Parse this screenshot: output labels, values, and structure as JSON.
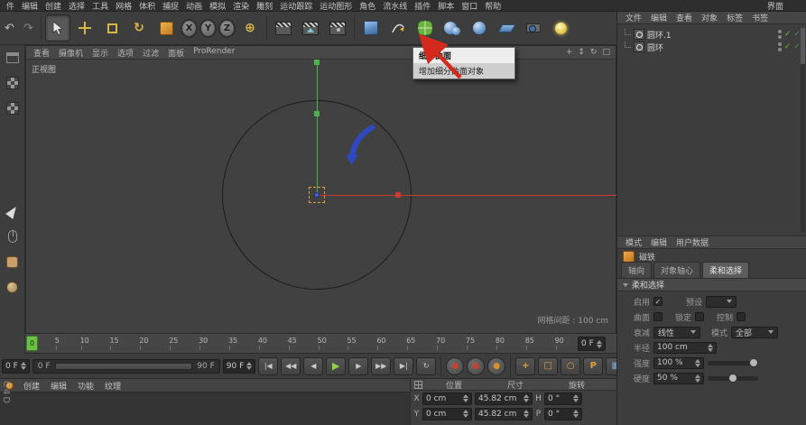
{
  "menubar": {
    "items": [
      "件",
      "编辑",
      "创建",
      "选择",
      "工具",
      "网格",
      "体积",
      "捕捉",
      "动画",
      "模拟",
      "渲染",
      "雕刻",
      "运动跟踪",
      "运动图形",
      "角色",
      "流水线",
      "插件",
      "脚本",
      "窗口",
      "帮助"
    ],
    "right_item": "界面"
  },
  "toolbar": {
    "undo_glyph": "↶",
    "redo_glyph": "↷",
    "rotate_glyph": "↻",
    "coord_glyph": "⊕",
    "axis_x": "X",
    "axis_y": "Y",
    "axis_z": "Z"
  },
  "tooltip": {
    "title": "细分曲面",
    "body": "增加细分曲面对象"
  },
  "viewport": {
    "menu": [
      "查看",
      "摄像机",
      "显示",
      "选项",
      "过滤",
      "面板",
      "ProRender"
    ],
    "nav_icons": [
      "+",
      "↕",
      "↻",
      "□"
    ],
    "view_label": "正视图",
    "grid_label": "网格间距 : 100 cm"
  },
  "timeline": {
    "ticks": [
      "0",
      "5",
      "10",
      "15",
      "20",
      "25",
      "30",
      "35",
      "40",
      "45",
      "50",
      "55",
      "60",
      "65",
      "70",
      "75",
      "80",
      "85",
      "90"
    ],
    "playhead_frame": "0",
    "current_frame": "0 F"
  },
  "transport": {
    "frame_start": "0 F",
    "range_start": "0 F",
    "range_end": "90 F",
    "frame_end": "90 F",
    "goto_start": "|◀",
    "prev_key": "◀◀",
    "prev_frame": "◀",
    "play": "▶",
    "next_frame": "▶",
    "next_key": "▶▶",
    "goto_end": "▶|",
    "loop": "↻",
    "record_dot": "●",
    "key_position": "+",
    "key_scale": "□",
    "key_rotation": "○",
    "key_parameter": "P",
    "key_pla": "▦"
  },
  "materials": {
    "tabs": [
      "创建",
      "编辑",
      "功能",
      "纹理"
    ],
    "logo": "C4D"
  },
  "coordinates": {
    "headers": [
      "位置",
      "尺寸",
      "旋转"
    ],
    "rows": [
      {
        "axis": "X",
        "pos": "0 cm",
        "size": "45.82 cm",
        "rot_axis": "H",
        "rot": "0 °"
      },
      {
        "axis": "Y",
        "pos": "0 cm",
        "size": "45.82 cm",
        "rot_axis": "P",
        "rot": "0 °"
      }
    ]
  },
  "object_manager": {
    "menu": [
      "文件",
      "编辑",
      "查看",
      "对象",
      "标签",
      "书签"
    ],
    "objects": [
      {
        "name": "圆环.1"
      },
      {
        "name": "圆环"
      }
    ]
  },
  "attribute_manager": {
    "menu": [
      "模式",
      "编辑",
      "用户数据"
    ],
    "tool_name": "磁铁",
    "tabs": [
      "轴向",
      "对象轴心",
      "柔和选择"
    ],
    "section": "柔和选择",
    "enable_label": "启用",
    "preset_label": "预设",
    "surface_label": "曲面",
    "lock_label": "锁定",
    "control_label": "控制",
    "falloff_label": "衰减",
    "falloff_value": "线性",
    "mode_label": "模式",
    "mode_value": "全部",
    "radius_label": "半径",
    "radius_value": "100 cm",
    "strength_label": "强度",
    "strength_value": "100 %",
    "hardness_label": "硬度",
    "hardness_value": "50 %"
  },
  "colors": {
    "accent_orange": "#e0a23c",
    "axis_green": "#4db34d",
    "axis_red": "#cc3b2e",
    "play_green": "#8ed04a",
    "record_red": "#c8402f",
    "check_green": "#6abf45",
    "annotation_red": "#d42a1e"
  }
}
